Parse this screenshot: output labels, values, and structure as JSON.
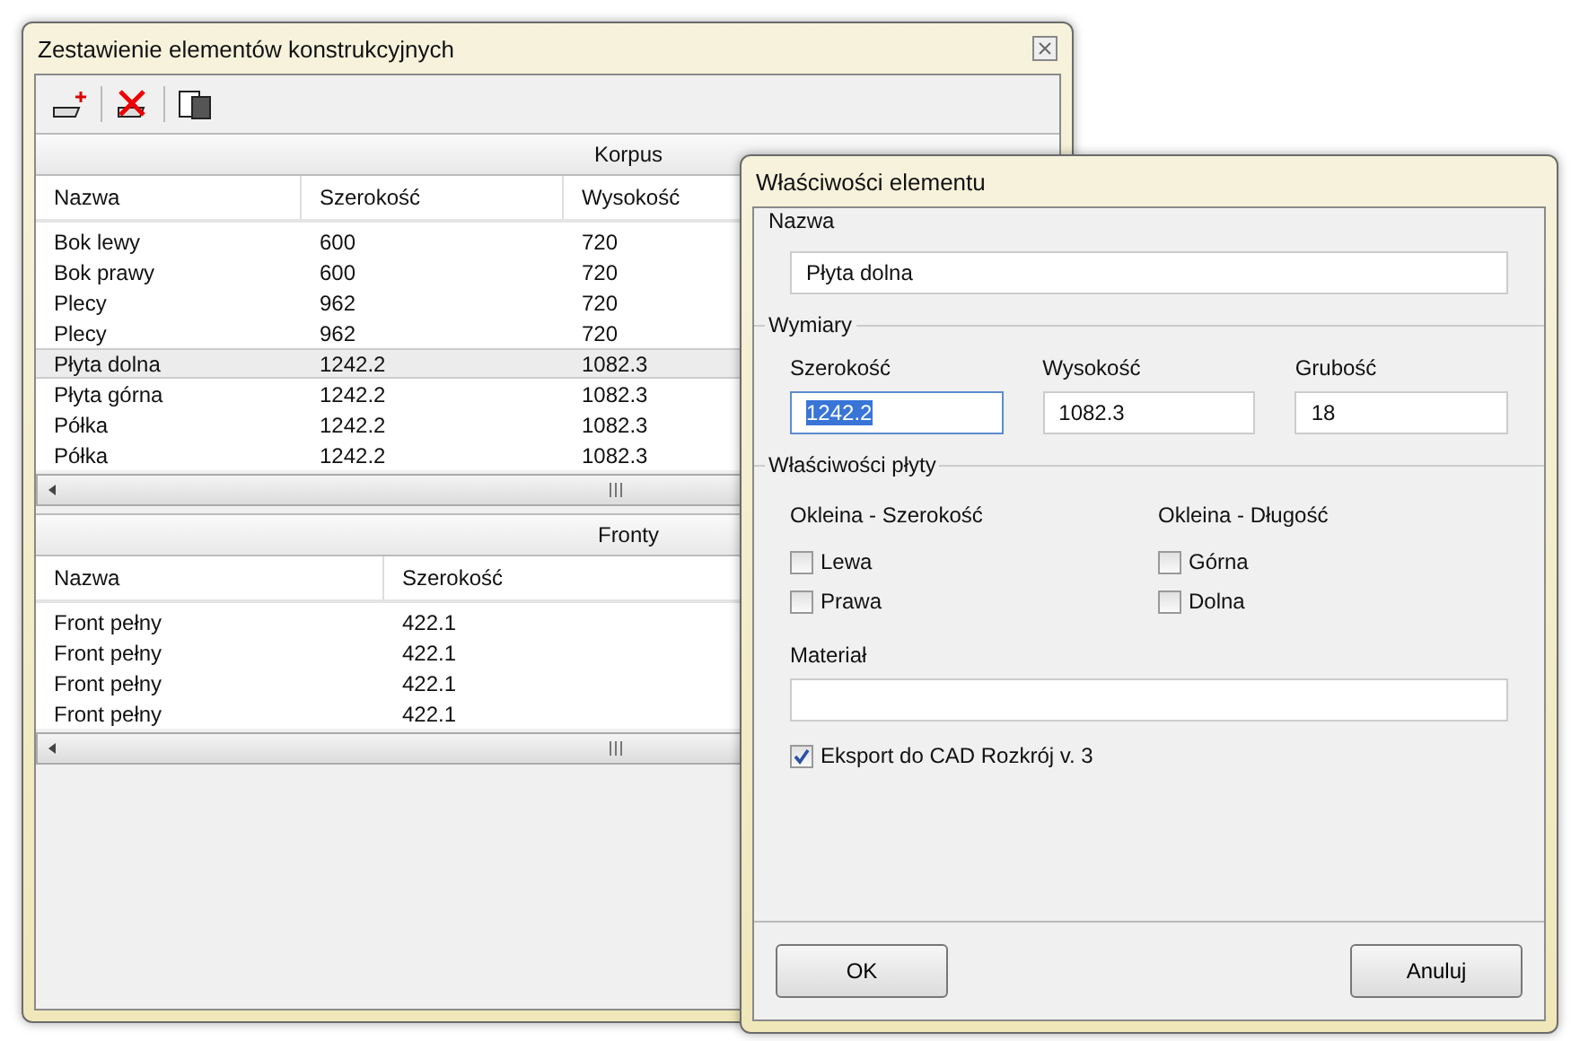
{
  "back_window": {
    "title": "Zestawienie elementów konstrukcyjnych",
    "tables": [
      {
        "group": "Korpus",
        "columns": [
          "Nazwa",
          "Szerokość",
          "Wysokość"
        ],
        "rows": [
          {
            "cells": [
              "Bok lewy",
              "600",
              "720"
            ],
            "selected": false
          },
          {
            "cells": [
              "Bok prawy",
              "600",
              "720"
            ],
            "selected": false
          },
          {
            "cells": [
              "Plecy",
              "962",
              "720"
            ],
            "selected": false
          },
          {
            "cells": [
              "Plecy",
              "962",
              "720"
            ],
            "selected": false
          },
          {
            "cells": [
              "Płyta dolna",
              "1242.2",
              "1082.3"
            ],
            "selected": true
          },
          {
            "cells": [
              "Płyta górna",
              "1242.2",
              "1082.3"
            ],
            "selected": false
          },
          {
            "cells": [
              "Półka",
              "1242.2",
              "1082.3"
            ],
            "selected": false
          },
          {
            "cells": [
              "Półka",
              "1242.2",
              "1082.3"
            ],
            "selected": false
          }
        ]
      },
      {
        "group": "Fronty",
        "columns": [
          "Nazwa",
          "Szerokość"
        ],
        "rows": [
          {
            "cells": [
              "Front pełny",
              "422.1"
            ],
            "selected": false
          },
          {
            "cells": [
              "Front pełny",
              "422.1"
            ],
            "selected": false
          },
          {
            "cells": [
              "Front pełny",
              "422.1"
            ],
            "selected": false
          },
          {
            "cells": [
              "Front pełny",
              "422.1"
            ],
            "selected": false
          }
        ]
      }
    ]
  },
  "dialog": {
    "title": "Właściwości elementu",
    "name_group": {
      "legend": "Nazwa",
      "value": "Płyta dolna"
    },
    "dimensions": {
      "legend": "Wymiary",
      "fields": [
        {
          "label": "Szerokość",
          "value": "1242.2",
          "selected": true
        },
        {
          "label": "Wysokość",
          "value": "1082.3",
          "selected": false
        },
        {
          "label": "Grubość",
          "value": "18",
          "selected": false
        }
      ]
    },
    "board": {
      "legend": "Właściwości płyty",
      "edge_columns": [
        {
          "heading": "Okleina - Szerokość",
          "options": [
            {
              "label": "Lewa",
              "checked": false
            },
            {
              "label": "Prawa",
              "checked": false
            }
          ]
        },
        {
          "heading": "Okleina - Długość",
          "options": [
            {
              "label": "Górna",
              "checked": false
            },
            {
              "label": "Dolna",
              "checked": false
            }
          ]
        }
      ],
      "material_label": "Materiał",
      "export": {
        "label": "Eksport do CAD Rozkrój v. 3",
        "checked": true
      }
    },
    "buttons": [
      "OK",
      "Anuluj"
    ]
  }
}
